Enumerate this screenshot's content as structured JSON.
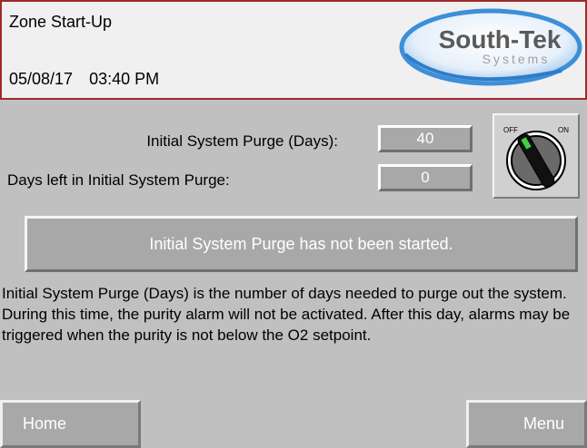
{
  "header": {
    "title": "Zone Start-Up",
    "date": "05/08/17",
    "time": "03:40 PM"
  },
  "logo": {
    "name": "South-Tek",
    "subtitle": "Systems"
  },
  "purge": {
    "initial_days_label": "Initial System Purge (Days):",
    "initial_days_value": "40",
    "days_left_label": "Days left in Initial System Purge:",
    "days_left_value": "0"
  },
  "switch": {
    "off_label": "OFF",
    "on_label": "ON",
    "state": "off"
  },
  "status_message": "Initial System Purge has not been started.",
  "description": "Initial System Purge (Days) is the number of days needed to purge out the system. During this time, the purity alarm will not be activated. After this day, alarms may be triggered when the purity is not below the O2 setpoint.",
  "nav": {
    "home_label": "Home",
    "menu_label": "Menu"
  },
  "colors": {
    "background": "#c0c0c0",
    "header_border": "#9c2b2b",
    "logo_blue": "#3c8fd8",
    "knob_green": "#3fd23f"
  }
}
